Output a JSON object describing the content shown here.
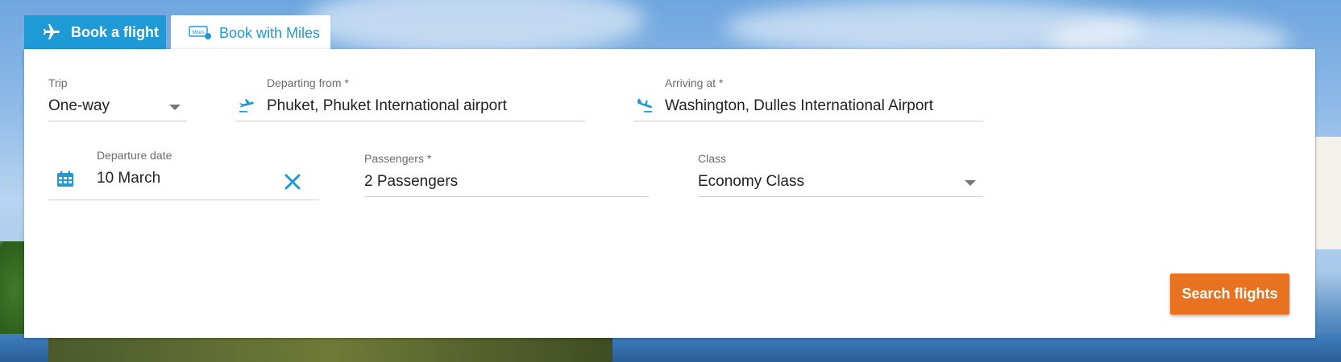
{
  "tabs": {
    "book_flight": {
      "label": "Book a flight",
      "icon": "airplane-icon"
    },
    "book_miles": {
      "label": "Book with Miles",
      "icon": "miles-icon",
      "icon_text": "Miles"
    }
  },
  "form": {
    "trip": {
      "label": "Trip",
      "value": "One-way"
    },
    "departing": {
      "label": "Departing from *",
      "value": "Phuket, Phuket International airport",
      "icon": "takeoff-icon"
    },
    "arriving": {
      "label": "Arriving at *",
      "value": "Washington, Dulles International Airport",
      "icon": "landing-icon"
    },
    "departure_date": {
      "label": "Departure date",
      "value": "10 March",
      "icon": "calendar-icon",
      "clear_icon": "close-icon"
    },
    "passengers": {
      "label": "Passengers *",
      "value": "2 Passengers"
    },
    "class": {
      "label": "Class",
      "value": "Economy Class"
    }
  },
  "actions": {
    "search_label": "Search flights"
  },
  "colors": {
    "accent": "#1e9ad6",
    "cta": "#e8721f"
  }
}
